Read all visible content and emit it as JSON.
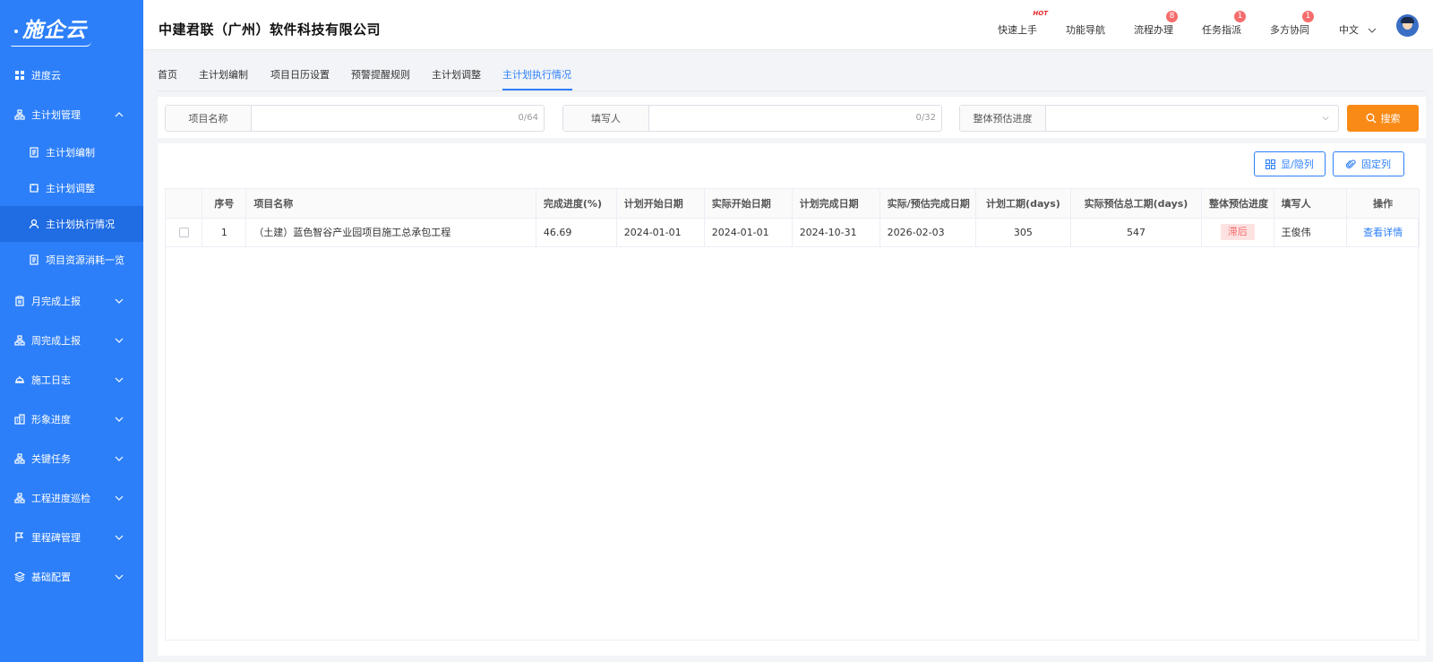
{
  "app": {
    "logo": "施企云"
  },
  "sidebar": {
    "items": [
      {
        "label": "进度云"
      },
      {
        "label": "主计划管理"
      },
      {
        "label": "主计划编制"
      },
      {
        "label": "主计划调整"
      },
      {
        "label": "主计划执行情况"
      },
      {
        "label": "项目资源消耗一览"
      },
      {
        "label": "月完成上报"
      },
      {
        "label": "周完成上报"
      },
      {
        "label": "施工日志"
      },
      {
        "label": "形象进度"
      },
      {
        "label": "关键任务"
      },
      {
        "label": "工程进度巡检"
      },
      {
        "label": "里程碑管理"
      },
      {
        "label": "基础配置"
      }
    ]
  },
  "header": {
    "company": "中建君联（广州）软件科技有限公司",
    "links": [
      {
        "label": "快速上手",
        "hot": "HOT"
      },
      {
        "label": "功能导航"
      },
      {
        "label": "流程办理",
        "badge": "8"
      },
      {
        "label": "任务指派",
        "badge": "1"
      },
      {
        "label": "多方协同",
        "badge": "1"
      }
    ],
    "language": "中文"
  },
  "tabs": [
    "首页",
    "主计划编制",
    "项目日历设置",
    "预警提醒规则",
    "主计划调整",
    "主计划执行情况"
  ],
  "search": {
    "project_name_label": "项目名称",
    "project_name_value": "",
    "project_name_count": "0/64",
    "filler_label": "填写人",
    "filler_value": "",
    "filler_count": "0/32",
    "progress_label": "整体预估进度",
    "progress_value": "",
    "search_button": "搜索"
  },
  "toolbar": {
    "show_hide": "显/隐列",
    "fix_cols": "固定列"
  },
  "table": {
    "headers": [
      "序号",
      "项目名称",
      "完成进度(%)",
      "计划开始日期",
      "实际开始日期",
      "计划完成日期",
      "实际/预估完成日期",
      "计划工期(days)",
      "实际预估总工期(days)",
      "整体预估进度",
      "填写人",
      "操作"
    ],
    "rows": [
      {
        "no": "1",
        "name": "（土建）蓝色智谷产业园项目施工总承包工程",
        "progress": "46.69",
        "plan_start": "2024-01-01",
        "actual_start": "2024-01-01",
        "plan_end": "2024-10-31",
        "est_end": "2026-02-03",
        "plan_days": "305",
        "est_days": "547",
        "status": "滞后",
        "filler": "王俊伟",
        "action": "查看详情"
      }
    ]
  }
}
